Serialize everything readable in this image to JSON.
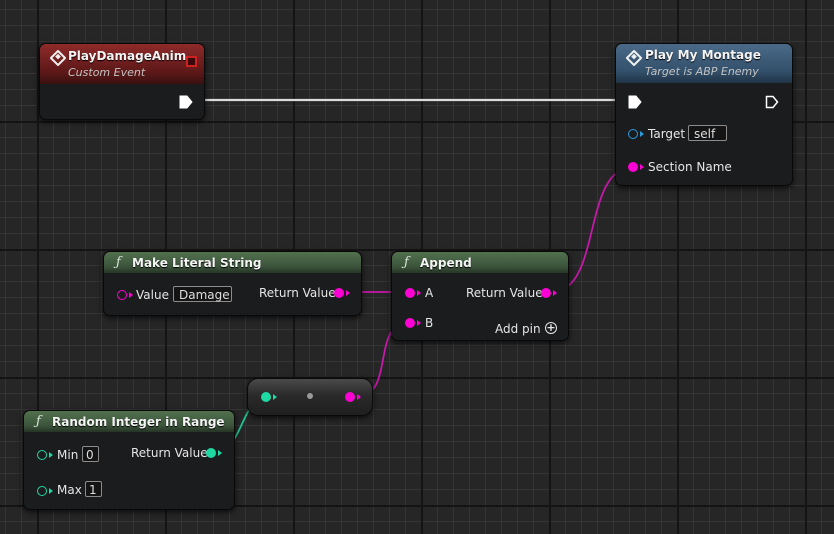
{
  "nodes": {
    "play_damage_anim": {
      "title": "PlayDamageAnim",
      "subtitle": "Custom Event"
    },
    "play_my_montage": {
      "title": "Play My Montage",
      "subtitle": "Target is ABP Enemy",
      "pins": {
        "target_label": "Target",
        "target_value": "self",
        "section_name_label": "Section Name"
      }
    },
    "make_literal_string": {
      "title": "Make Literal String",
      "pins": {
        "value_label": "Value",
        "value_input": "Damage",
        "return_label": "Return Value"
      }
    },
    "append": {
      "title": "Append",
      "pins": {
        "a_label": "A",
        "b_label": "B",
        "return_label": "Return Value",
        "add_pin_label": "Add pin"
      }
    },
    "random_integer_in_range": {
      "title": "Random Integer in Range",
      "pins": {
        "min_label": "Min",
        "min_value": "0",
        "max_label": "Max",
        "max_value": "1",
        "return_label": "Return Value"
      }
    }
  },
  "icons": {
    "event": "event-diamond-icon",
    "function": "function-f-icon",
    "exec": "exec-arrow-icon",
    "add": "plus-circle-icon"
  },
  "colors": {
    "string_pin": "#ff00d4",
    "integer_pin": "#1ed9a4",
    "object_pin": "#2a9ae0",
    "exec_pin": "#ffffff",
    "event_header": "#8e2a2a",
    "function_header": "#3b543b",
    "call_header": "#33506b"
  }
}
